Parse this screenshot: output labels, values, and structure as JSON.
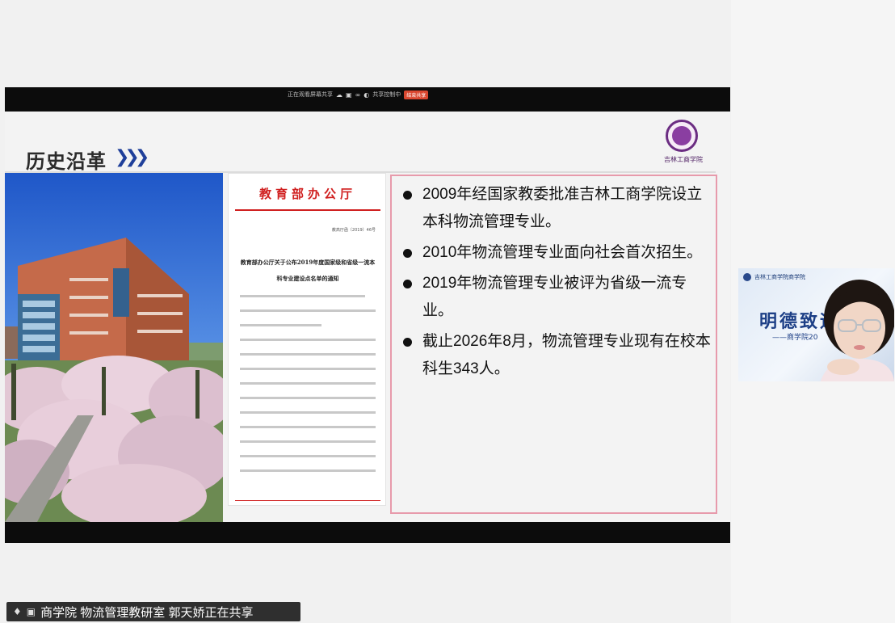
{
  "share_toolbar": {
    "info_text": "正在观看屏幕共享",
    "button_text": "共享控制中",
    "stop_label": "结束共享"
  },
  "slide": {
    "title": "历史沿革",
    "logo_text": "吉林工商学院",
    "document": {
      "header": "教育部办公厅",
      "doc_number": "教高厅函〔2019〕46号",
      "title": "教育部办公厅关于公布2019年度国家级和省级一流本科专业建设点名单的通知"
    },
    "bullets": [
      "2009年经国家教委批准吉林工商学院设立本科物流管理专业。",
      "2010年物流管理专业面向社会首次招生。",
      "2019年物流管理专业被评为省级一流专业。",
      "截止2026年8月，物流管理专业现有在校本科生343人。"
    ]
  },
  "video_tile": {
    "org": "吉林工商学院商学院",
    "motto": "明德致远",
    "subtitle": "——商学院20"
  },
  "status_bar": {
    "text": "商学院 物流管理教研室  郭天娇正在共享"
  },
  "colors": {
    "title_chevron": "#1f3f9a",
    "doc_red": "#d02020",
    "text_box_border": "#e79aab",
    "stop_button": "#d9472f"
  }
}
